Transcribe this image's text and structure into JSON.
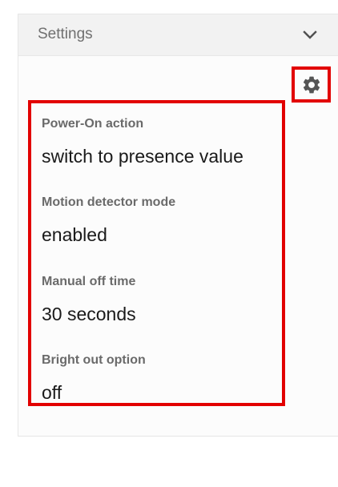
{
  "panel": {
    "title": "Settings",
    "collapse_icon": "chevron-down-icon",
    "settings_icon": "gear-icon"
  },
  "settings": [
    {
      "label": "Power-On action",
      "value": "switch to presence value"
    },
    {
      "label": "Motion detector mode",
      "value": "enabled"
    },
    {
      "label": "Manual off time",
      "value": "30 seconds"
    },
    {
      "label": "Bright out option",
      "value": "off"
    }
  ],
  "colors": {
    "highlight": "#e20000",
    "header_bg": "#f2f2f2",
    "label_text": "#6a6a6a",
    "value_text": "#1a1a1a"
  }
}
